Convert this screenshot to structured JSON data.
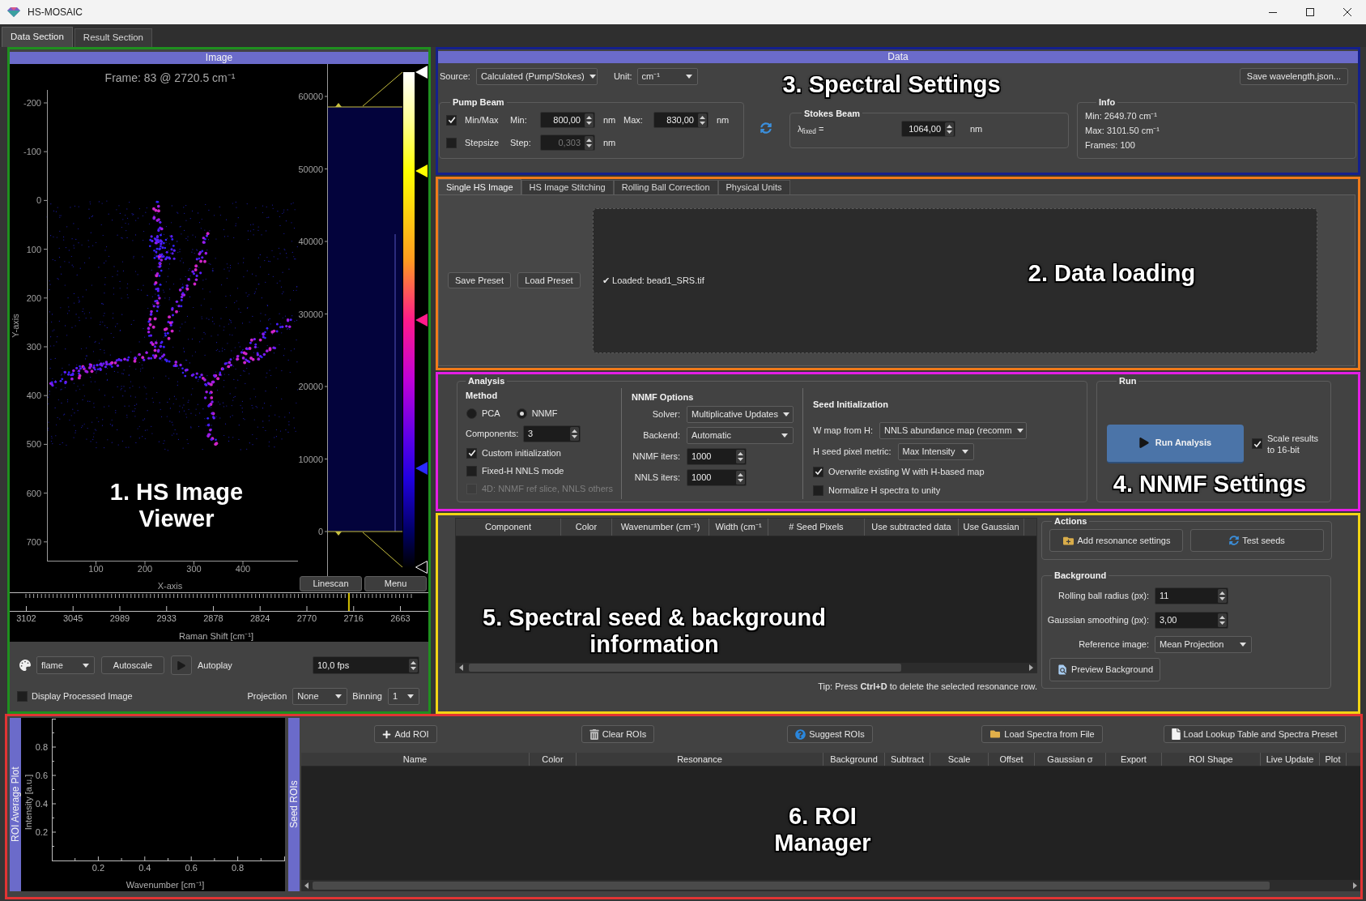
{
  "window": {
    "title": "HS-MOSAIC"
  },
  "main_tabs": [
    {
      "label": "Data Section",
      "selected": true
    },
    {
      "label": "Result Section",
      "selected": false
    }
  ],
  "image_viewer": {
    "annotation": {
      "label": "1. HS Image Viewer",
      "color": "#1f8f1f"
    },
    "header": "Image",
    "frame_title": "Frame: 83 @ 2720.5 cm⁻¹",
    "y_axis_label": "Y-axis",
    "y_ticks": [
      "-200",
      "-100",
      "0",
      "100",
      "200",
      "300",
      "400",
      "500",
      "600",
      "700"
    ],
    "x_axis_label": "X-axis",
    "x_ticks": [
      "100",
      "200",
      "300",
      "400"
    ],
    "histogram_ticks": [
      "60000",
      "50000",
      "40000",
      "30000",
      "20000",
      "10000",
      "0"
    ],
    "plot_buttons": [
      "Linescan",
      "Menu"
    ],
    "spectrum_axis": {
      "label": "Raman Shift [cm⁻¹]",
      "ticks": [
        "3102",
        "3045",
        "2989",
        "2933",
        "2878",
        "2824",
        "2770",
        "2716",
        "2663"
      ],
      "level": 0.838
    },
    "controls": {
      "colormap": "flame",
      "autoscale_button": "Autoscale",
      "autoplay_label": "Autoplay",
      "fps": "10,0 fps",
      "display_processed": {
        "label": "Display Processed Image",
        "checked": false
      },
      "projection": {
        "label": "Projection",
        "value": "None"
      },
      "binning": {
        "label": "Binning",
        "value": "1"
      }
    }
  },
  "data_panel": {
    "annotation": {
      "label": "3. Spectral Settings",
      "color": "#14208c"
    },
    "header": "Data",
    "source": {
      "label": "Source:",
      "value": "Calculated (Pump/Stokes)"
    },
    "unit": {
      "label": "Unit:",
      "value": "cm⁻¹"
    },
    "save_button": "Save wavelength.json...",
    "pump_beam": {
      "title": "Pump Beam",
      "rows": [
        {
          "label": "Min/Max",
          "checked": true,
          "fields": [
            {
              "label": "Min:",
              "value": "800,00",
              "unit": "nm",
              "disabled": false
            },
            {
              "label": "Max:",
              "value": "830,00",
              "unit": "nm",
              "disabled": false
            }
          ]
        },
        {
          "label": "Stepsize",
          "checked": false,
          "fields": [
            {
              "label": "Step:",
              "value": "0,303",
              "unit": "nm",
              "disabled": true
            }
          ]
        }
      ]
    },
    "stokes_beam": {
      "title": "Stokes Beam",
      "label": "λ$_{fixed}$ =",
      "value": "1064,00",
      "unit": "nm"
    },
    "info": {
      "title": "Info",
      "lines": [
        "Min: 2649.70 cm⁻¹",
        "Max: 3101.50 cm⁻¹",
        "Frames: 100"
      ]
    }
  },
  "data_loading": {
    "annotation": {
      "label": "2. Data loading",
      "color": "#f07a1a"
    },
    "tabs": [
      {
        "label": "Single HS Image",
        "selected": true
      },
      {
        "label": "HS Image Stitching",
        "selected": false
      },
      {
        "label": "Rolling Ball Correction",
        "selected": false
      },
      {
        "label": "Physical Units",
        "selected": false
      }
    ],
    "buttons": [
      "Save Preset",
      "Load Preset"
    ],
    "log": "✔ Loaded: bead1_SRS.tif"
  },
  "nnmf_settings": {
    "annotation": {
      "label": "4. NNMF Settings",
      "color": "#e41ee4"
    },
    "analysis": {
      "title": "Analysis",
      "method": {
        "title": "Method",
        "options": [
          {
            "label": "PCA",
            "selected": false
          },
          {
            "label": "NNMF",
            "selected": true
          }
        ]
      },
      "components": {
        "label": "Components:",
        "value": "3"
      },
      "checks": [
        {
          "label": "Custom initialization",
          "checked": true,
          "disabled": false
        },
        {
          "label": "Fixed-H NNLS mode",
          "checked": false,
          "disabled": false
        },
        {
          "label": "4D: NNMF ref slice, NNLS others",
          "checked": false,
          "disabled": true
        }
      ],
      "nnmf_options": {
        "title": "NNMF Options",
        "fields": [
          {
            "kind": "dropdown",
            "label": "Solver:",
            "value": "Multiplicative Updates"
          },
          {
            "kind": "dropdown",
            "label": "Backend:",
            "value": "Automatic"
          },
          {
            "kind": "spin",
            "label": "NNMF iters:",
            "value": "1000"
          },
          {
            "kind": "spin",
            "label": "NNLS iters:",
            "value": "1000"
          }
        ]
      },
      "seed_initialization": {
        "title": "Seed Initialization",
        "fields": [
          {
            "kind": "dropdown",
            "label": "W map from H:",
            "value": "NNLS abundance map (recomm"
          },
          {
            "kind": "dropdown",
            "label": "H seed pixel metric:",
            "value": "Max Intensity"
          }
        ],
        "checks": [
          {
            "label": "Overwrite existing W with H-based map",
            "checked": true
          },
          {
            "label": "Normalize H spectra to unity",
            "checked": false
          }
        ]
      }
    },
    "run": {
      "title": "Run",
      "button": "Run Analysis",
      "scale_check": {
        "label": "Scale results to 16-bit",
        "checked": true
      }
    }
  },
  "seed_panel": {
    "annotation": {
      "label": "5. Spectral seed & background information",
      "color": "#f2d414"
    },
    "table": {
      "columns": [
        "Component",
        "Color",
        "Wavenumber (cm⁻¹)",
        "Width (cm⁻¹",
        "# Seed Pixels",
        "Use subtracted data",
        "Use Gaussian"
      ]
    },
    "tip": "Tip: Press **Ctrl+D** to delete the selected resonance row.",
    "actions": {
      "title": "Actions",
      "buttons": [
        "Add resonance settings",
        "Test seeds"
      ]
    },
    "background": {
      "title": "Background",
      "fields": [
        {
          "kind": "spin",
          "label": "Rolling ball radius (px):",
          "value": "11"
        },
        {
          "kind": "spin",
          "label": "Gaussian smoothing (px):",
          "value": "3,00"
        },
        {
          "kind": "dropdown",
          "label": "Reference image:",
          "value": "Mean Projection"
        }
      ],
      "button": "Preview Background"
    }
  },
  "roi_manager": {
    "annotation": {
      "label": "6. ROI Manager",
      "color": "#e23434"
    },
    "plot_title": "ROI Average Plot",
    "chart_data": {
      "type": "line",
      "xlabel": "Wavenumber [cm⁻¹]",
      "ylabel": "Intensity [a.u.]",
      "xlim": [
        0,
        1
      ],
      "ylim": [
        0,
        1
      ],
      "xticks": [
        0.2,
        0.4,
        0.6,
        0.8
      ],
      "yticks": [
        0.2,
        0.4,
        0.6,
        0.8
      ]
    },
    "seed_tab": "Seed ROIs",
    "buttons": [
      "Add ROI",
      "Clear ROIs",
      "Suggest ROIs",
      "Load Spectra from File",
      "Load Lookup Table and Spectra Preset"
    ],
    "table": {
      "columns": [
        "Name",
        "Color",
        "Resonance",
        "Background",
        "Subtract",
        "Scale",
        "Offset",
        "Gaussian σ",
        "Export",
        "ROI Shape",
        "Live Update",
        "Plot"
      ]
    }
  }
}
